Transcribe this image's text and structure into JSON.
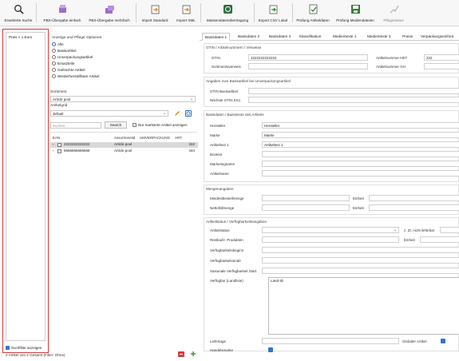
{
  "toolbar": {
    "items": [
      {
        "label": "Erweiterte Suche",
        "icon": "search-icon"
      },
      {
        "label": "PBS-Übergabe einfach",
        "icon": "transfer-icon"
      },
      {
        "label": "PBS-Übergabe mehrfach",
        "icon": "transfer-multiple-icon"
      },
      {
        "label": "Import Standard",
        "icon": "import-icon"
      },
      {
        "label": "Import XML",
        "icon": "import-xml-icon"
      },
      {
        "label": "Massendatenübertragung",
        "icon": "mass-transfer-icon"
      },
      {
        "label": "Export CSV Lokal",
        "icon": "export-csv-icon"
      },
      {
        "label": "Prüfung Artikeldaten",
        "icon": "check-article-icon"
      },
      {
        "label": "Prüfung Mediendateien",
        "icon": "check-media-icon"
      },
      {
        "label": "Pflegestatus",
        "icon": "status-icon"
      }
    ]
  },
  "filter_panel": {
    "entry": "Preis < 1 Euro",
    "checkbox_label": "Suchfilter anzeigen"
  },
  "middle": {
    "section_title": "Anzeige und Pflege Optionen",
    "options": [
      "Alle",
      "Basisartikel",
      "Unverpackungsartikel",
      "Ersatzteile",
      "Gelöschte Artikel",
      "Wiederherstellbare Artikel"
    ],
    "sortiment_label": "Sortiment",
    "sortiment_value": "Article pool",
    "artikelgrid_label": "Artikelgrid",
    "artikelgrid_value": "default",
    "search_placeholder": "Suchen...",
    "search_button": "Search",
    "only_marked_label": "Nur markierte Artikel anzeigen",
    "table_headers": [
      "EAN",
      "Assortmentid",
      "UMVERPACKUNG",
      "ART"
    ],
    "rows": [
      {
        "ean": "2222222222222",
        "assortment": "Article pool",
        "art": "222"
      },
      {
        "ean": "6666666666666",
        "assortment": "Article pool",
        "art": "444"
      }
    ]
  },
  "detail": {
    "tabs": [
      "Basisdaten 1",
      "Basisdaten 2",
      "Basisdaten 3",
      "Klassifikation",
      "Medientexte 1",
      "Medientexte 2",
      "Preise",
      "Verpackungseinheit"
    ],
    "gtin_group": {
      "title": "GTIN / Artikelnummern / Verweise",
      "gtin_label": "GTIN",
      "gtin_value": "2222222222222",
      "sortiment_label": "Sortimentsverweis",
      "artnr_het_label": "Artikelnummer HET",
      "artnr_het_value": "222",
      "artnr_gh_label": "Artikelnummer GH"
    },
    "base_group": {
      "title": "Angaben zum Basisartikel bei Unverpackungsartikel",
      "gtin_basis_label": "GTIN Basisartikel",
      "next_gtin_label": "Nächste GTIN ES1"
    },
    "master_group": {
      "title": "Basisdaten / Basistexte des Artikels",
      "fields": [
        {
          "label": "Hersteller",
          "value": "Hersteller"
        },
        {
          "label": "Marke",
          "value": "Marke"
        },
        {
          "label": "Artikeltext 1",
          "value": "Artikeltext 1"
        },
        {
          "label": "Bontext",
          "value": ""
        },
        {
          "label": "Marketingname",
          "value": ""
        },
        {
          "label": "Artikelname",
          "value": ""
        }
      ]
    },
    "qty_group": {
      "title": "Mengenangaben",
      "min_label": "Mindestbestellmenge",
      "unit_label": "Einheit",
      "net_label": "Nettofüllmenge",
      "unit2_label": "Einheit"
    },
    "status_group": {
      "title": "Artikelstatus / Verfügbarkeitsangaben",
      "artikelstatus_label": "Artikelstatus",
      "zzt_label": "z. Zt. nicht lieferbar",
      "rest_label": "Restlaufz. Produkten",
      "unit_label": "Einheit",
      "begin_label": "Verfügbarkeitsbeginn",
      "end_label": "Verfügbarkeitsende",
      "season_label": "Saisonale Verfügbarkeit Start",
      "country_label": "Verfügbar (Landliste)",
      "country_value": "Land-ID",
      "liefertage_label": "Liefertage",
      "global_label": "Globaler Artikel",
      "handelsmarke_label": "Handelsmarke"
    }
  },
  "status_bar": "2 Artikel von 2 Gesamt (Filter: Ohne)"
}
